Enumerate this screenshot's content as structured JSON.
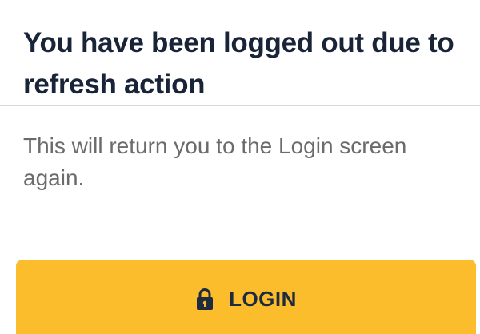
{
  "dialog": {
    "title": "You have been logged out due to refresh action",
    "message": "This will return you to the Login screen again.",
    "login_button": {
      "label": "LOGIN",
      "icon": "lock-icon"
    }
  },
  "colors": {
    "title": "#1a2438",
    "message": "#6b6b6b",
    "button_bg": "#fbbd2b",
    "button_text": "#1e2a3f",
    "divider": "#d9d9d9"
  }
}
